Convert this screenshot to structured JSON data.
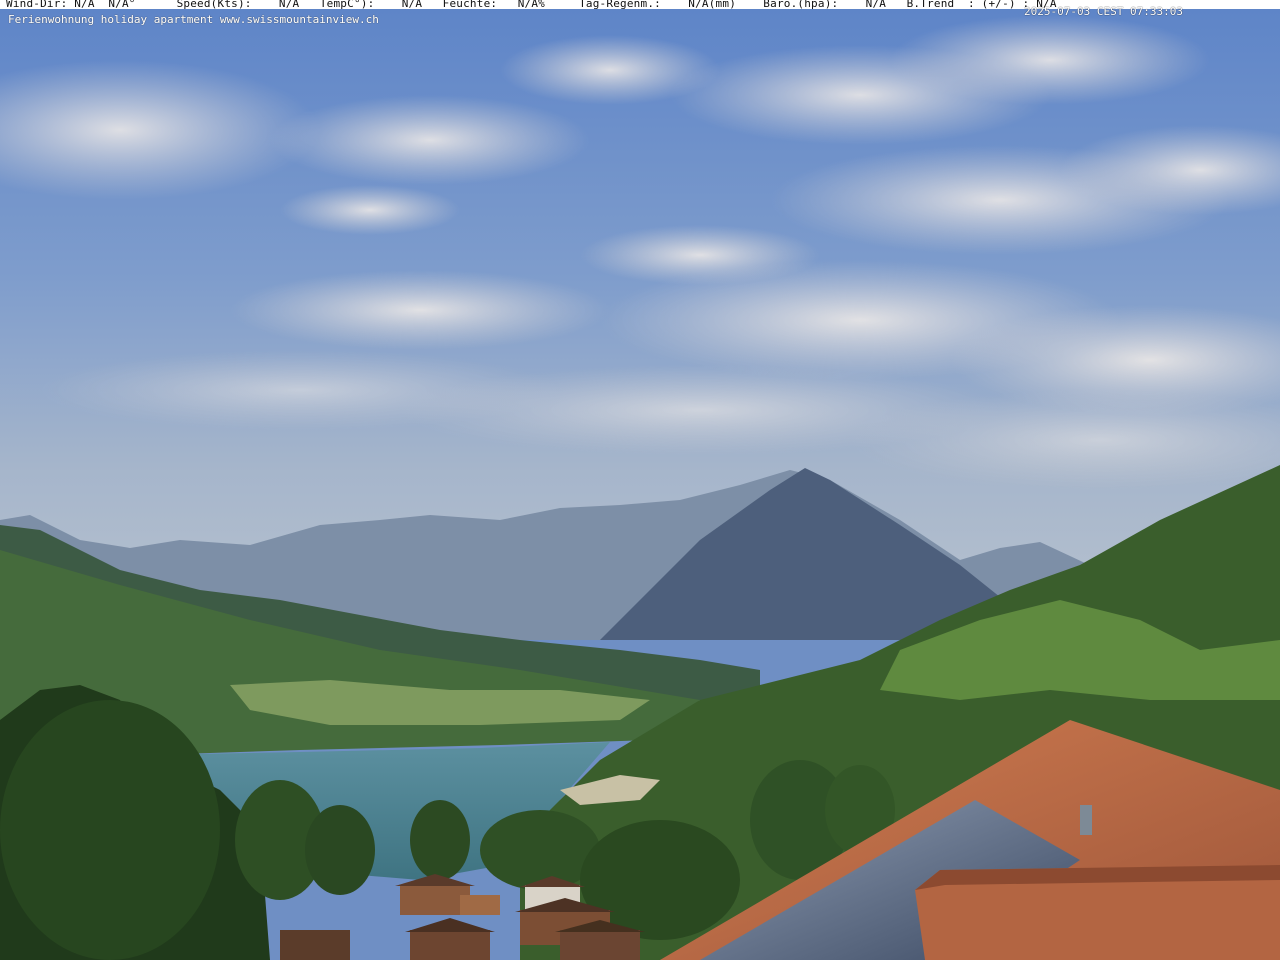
{
  "overlay": {
    "weather_line": "Wind-Dir: N/A  N/A°      Speed(Kts):    N/A   TempC°):    N/A   Feuchte:   N/A%     Tag-Regenm.:    N/A(mm)    Baro.(hpa):    N/A   B.Trend  : (+/-) : N/A",
    "timestamp": "2025-07-03 CEST 07:33:03",
    "caption": "Ferienwohnung holiday apartment www.swissmountainview.ch"
  },
  "scene": {
    "description_icons": [
      "sky",
      "clouds",
      "mountain-range",
      "peak",
      "lake",
      "forest",
      "village",
      "roof",
      "solar-panels"
    ],
    "colors": {
      "sky_top": "#5f86c8",
      "sky_bottom": "#a9b9cf",
      "lake": "#4f8594",
      "roof": "#b86a45",
      "forest": "#2b4a22"
    }
  }
}
